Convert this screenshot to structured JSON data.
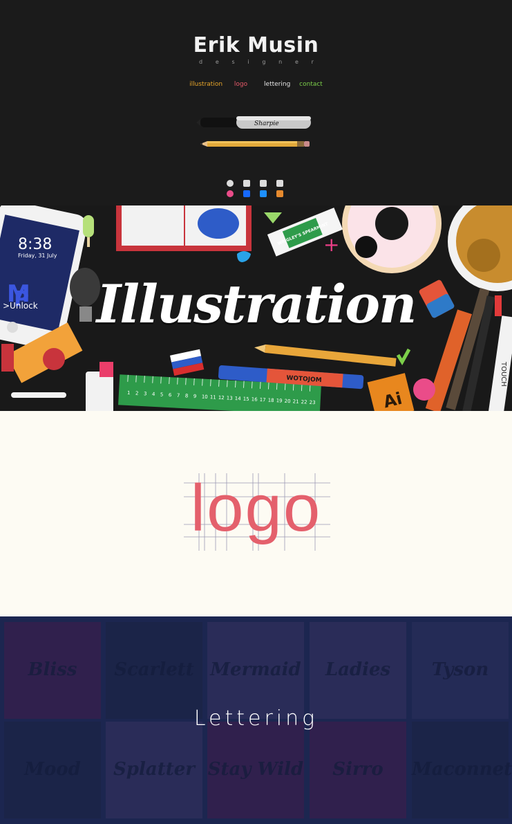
{
  "header": {
    "name": "Erik Musin",
    "subtitle_letters": [
      "d",
      "e",
      "s",
      "i",
      "g",
      "n",
      "e",
      "r"
    ],
    "nav": {
      "illustration": "illustration",
      "logo": "logo",
      "lettering": "lettering",
      "contact": "contact"
    },
    "marker_brand": "Sharpie",
    "social_icons": [
      "dribbble-icon",
      "behance-icon",
      "bookmark-icon",
      "instagram-icon"
    ]
  },
  "illustration": {
    "title": "Illustration",
    "phone_time": "8:38",
    "phone_date": "Friday, 31 July",
    "phone_unlock": ">Unlock",
    "phone_letters": [
      "M",
      "P"
    ],
    "gum_label": "WRIGLEY'S SPEARMINT",
    "marker_label": "WOTOJOM",
    "touch_label": "TOUCH",
    "ai_label": "Ai",
    "ruler_numbers": [
      "1",
      "2",
      "3",
      "4",
      "5",
      "6",
      "7",
      "8",
      "9",
      "10",
      "11",
      "12",
      "13",
      "14",
      "15",
      "16",
      "17",
      "18",
      "19",
      "20",
      "21",
      "22",
      "23"
    ]
  },
  "logo": {
    "word": "logo",
    "color": "#e4606c"
  },
  "lettering": {
    "title": "Lettering",
    "tiles": [
      "Bliss",
      "Scarlett",
      "Mermaid",
      "Ladies",
      "Tyson",
      "Mood",
      "Splatter",
      "Stay Wild",
      "Sirro",
      "Maconnet"
    ],
    "accent": "#1c2650"
  }
}
